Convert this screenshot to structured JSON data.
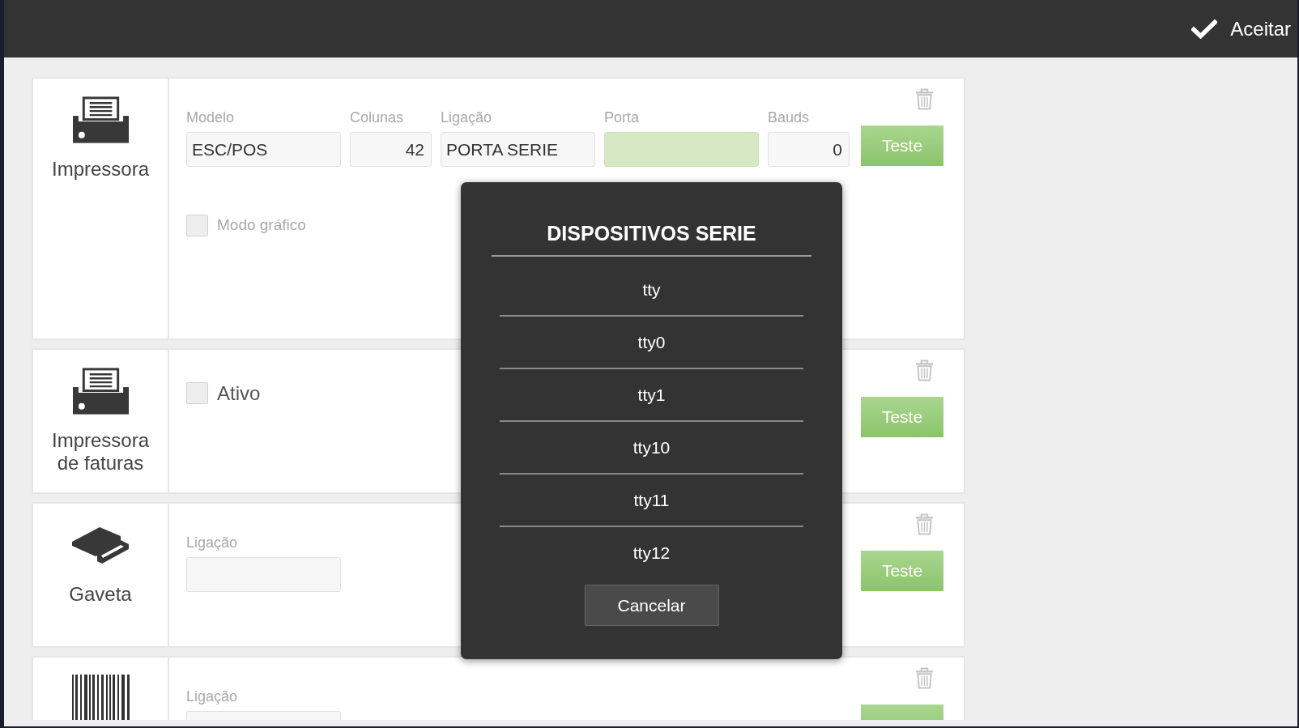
{
  "top_bar": {
    "accept_button": {
      "label": "Aceitar"
    }
  },
  "devices": [
    {
      "kind": "printer",
      "name": "Impressora",
      "fields": [
        {
          "label": "Modelo",
          "value": "ESC/POS",
          "kind": "text",
          "active": false
        },
        {
          "label": "Colunas",
          "value": "42",
          "kind": "number",
          "active": false
        },
        {
          "label": "Ligação",
          "value": "PORTA SERIE",
          "kind": "text",
          "active": false
        },
        {
          "label": "Porta",
          "kind": "text",
          "active": true
        },
        {
          "label": "Bauds",
          "value": "0",
          "kind": "number",
          "active": false
        }
      ],
      "options": [
        {
          "label": "Modo gráfico",
          "checked": false
        }
      ],
      "test_button_label": "Teste"
    },
    {
      "kind": "printer",
      "name": "Impressora de faturas",
      "enable_toggle": {
        "label": "Ativo",
        "checked": false
      },
      "test_button_label": "Teste"
    },
    {
      "kind": "drawer",
      "name": "Gaveta",
      "fields": [
        {
          "label": "Ligação",
          "kind": "text",
          "active": false
        }
      ],
      "test_button_label": "Teste"
    },
    {
      "kind": "barcode",
      "fields": [
        {
          "label": "Ligação",
          "kind": "text",
          "active": false
        }
      ]
    }
  ],
  "dialog": {
    "title": "DISPOSITIVOS SERIE",
    "items": [
      "tty",
      "tty0",
      "tty1",
      "tty10",
      "tty11",
      "tty12"
    ],
    "cancel_button": "Cancelar"
  }
}
